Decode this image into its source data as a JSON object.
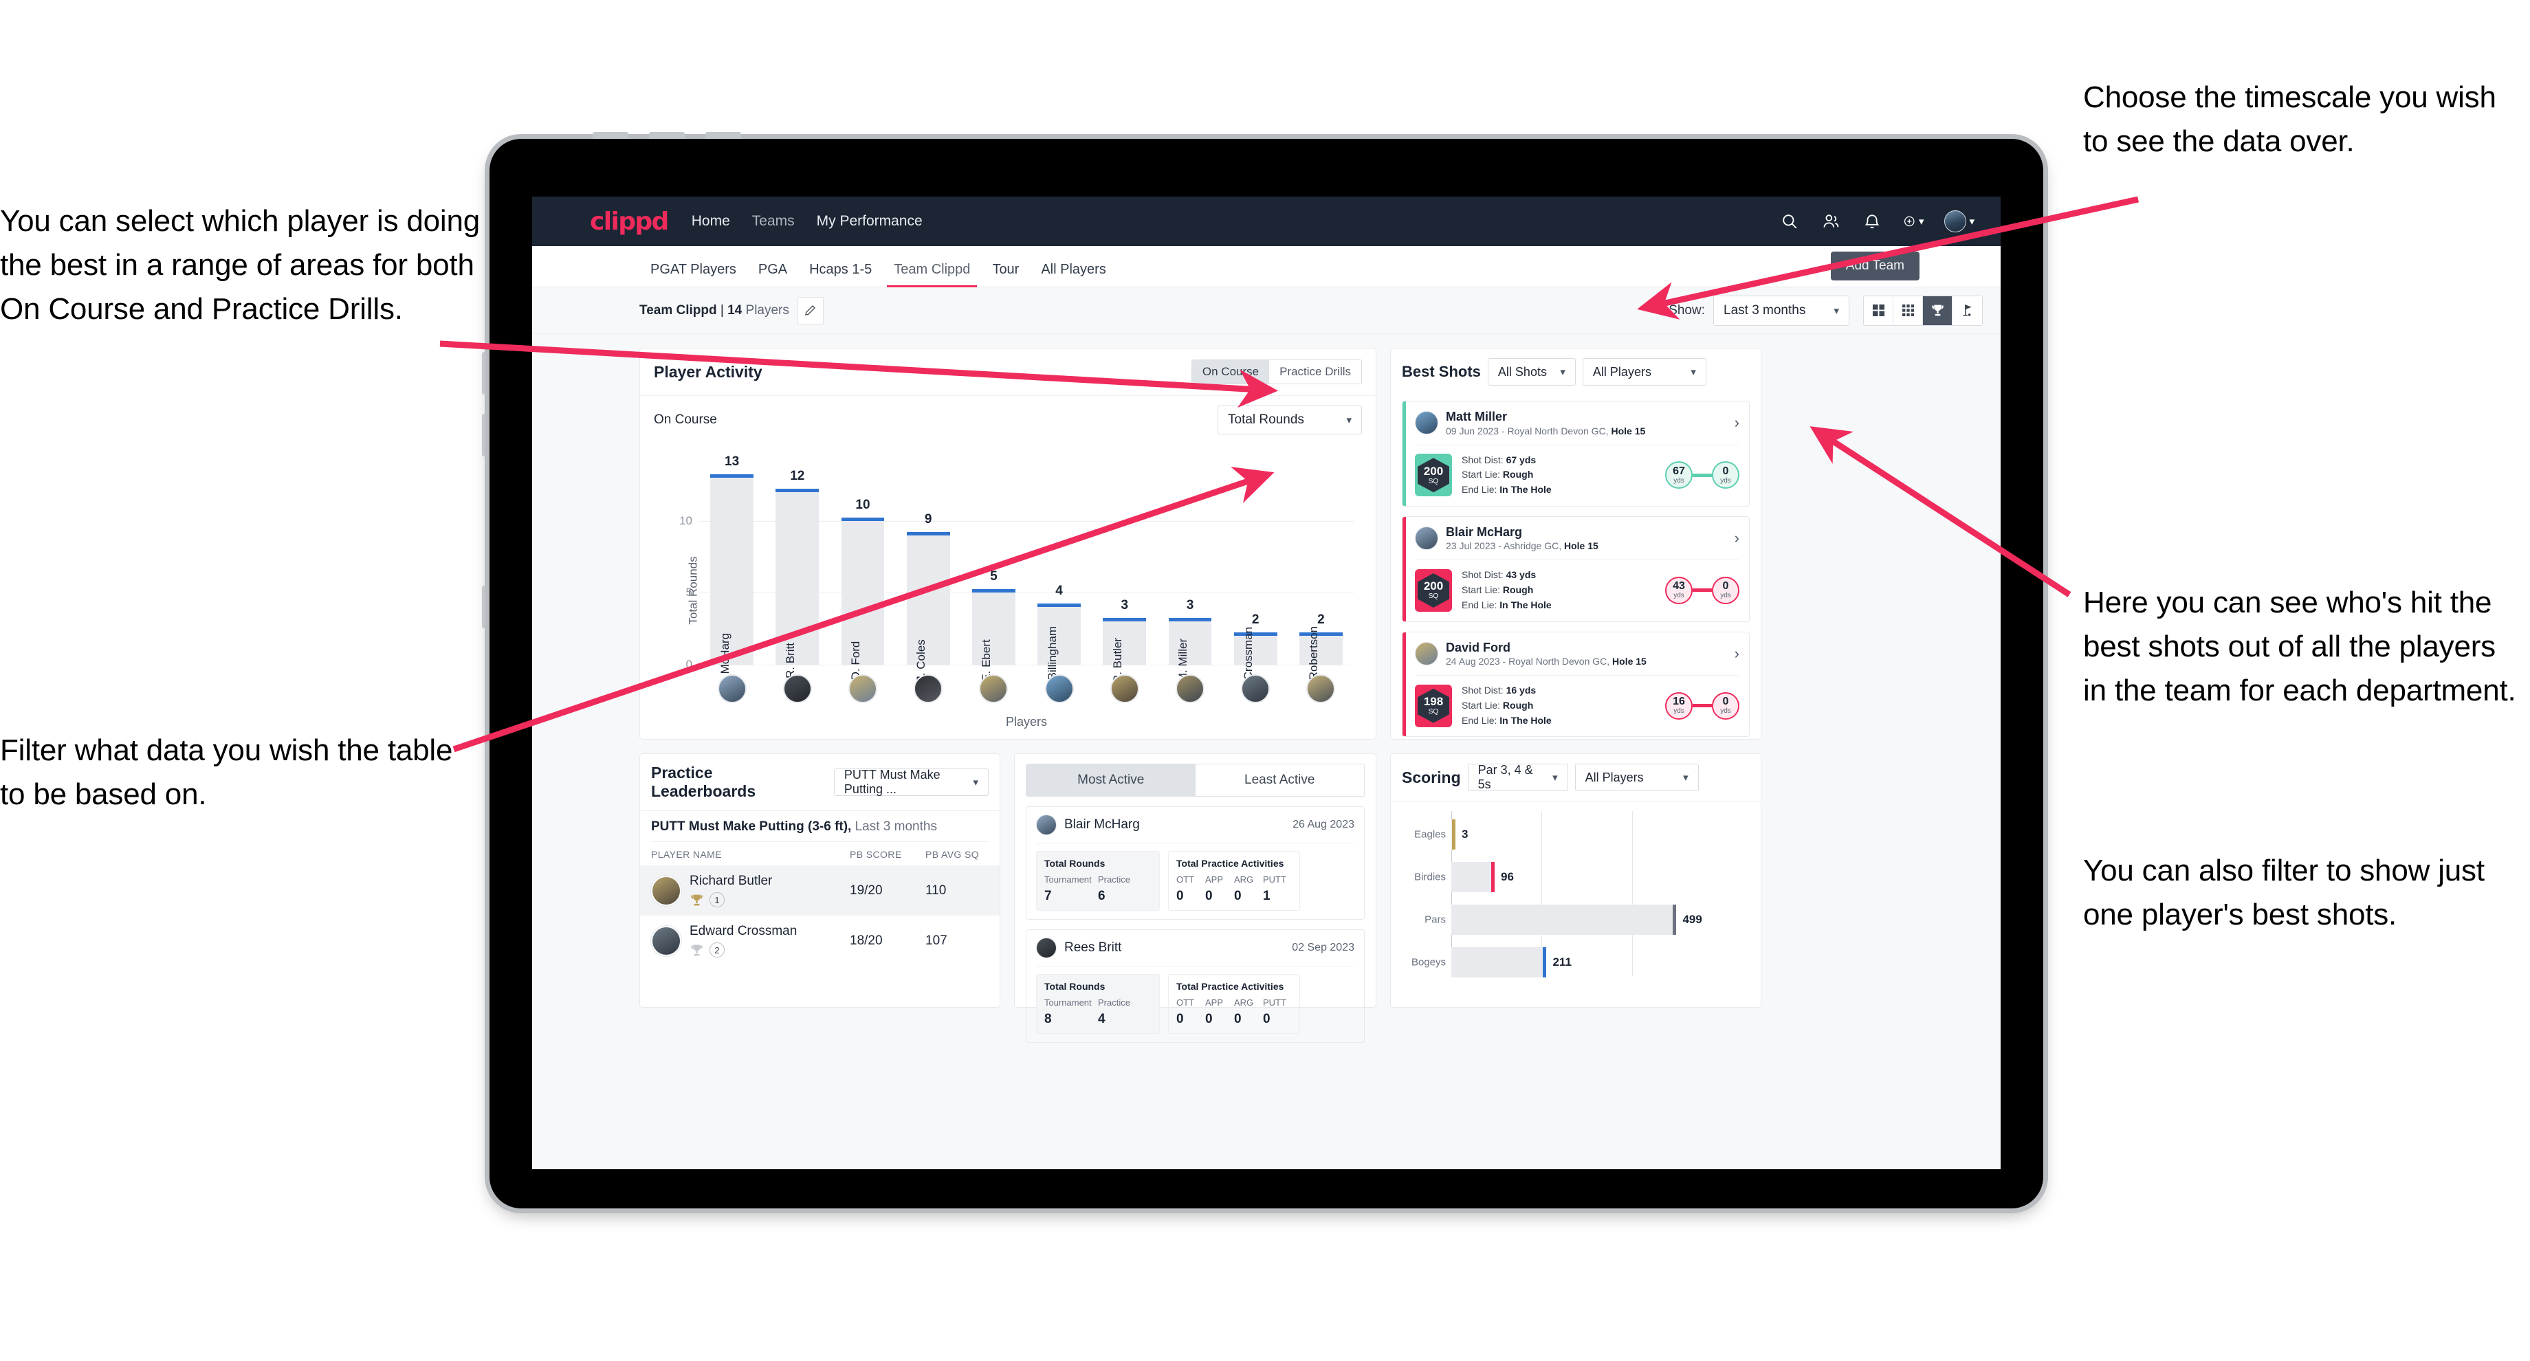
{
  "annotations": {
    "left_top": "You can select which player is doing the best in a range of areas for both On Course and Practice Drills.",
    "left_bottom": "Filter what data you wish the table to be based on.",
    "right_top": "Choose the timescale you wish to see the data over.",
    "right_middle": "Here you can see who's hit the best shots out of all the players in the team for each department.",
    "right_bottom": "You can also filter to show just one player's best shots."
  },
  "topnav": {
    "brand": "clippd",
    "links": [
      {
        "label": "Home"
      },
      {
        "label": "Teams"
      },
      {
        "label": "My Performance"
      }
    ],
    "icons": [
      "search-icon",
      "people-icon",
      "bell-icon",
      "plus-circle-icon",
      "avatar"
    ]
  },
  "tabs": [
    {
      "label": "PGAT Players",
      "active": false
    },
    {
      "label": "PGA",
      "active": false
    },
    {
      "label": "Hcaps 1-5",
      "active": false
    },
    {
      "label": "Team Clippd",
      "active": true
    },
    {
      "label": "Tour",
      "active": false
    },
    {
      "label": "All Players",
      "active": false
    }
  ],
  "add_team_button": "Add Team",
  "subbar": {
    "team_name": "Team Clippd",
    "separator": " | ",
    "player_count": "14",
    "players_word": " Players",
    "show_label": "Show:",
    "timescale_value": "Last 3 months",
    "view_toggles": [
      "grid-large-icon",
      "grid-small-icon",
      "trophy-icon",
      "flag-icon"
    ],
    "active_view": "trophy-icon"
  },
  "player_activity": {
    "title": "Player Activity",
    "segments": [
      {
        "label": "On Course",
        "active": true
      },
      {
        "label": "Practice Drills",
        "active": false
      }
    ],
    "sub_label": "On Course",
    "metric_value": "Total Rounds"
  },
  "best_shots": {
    "title": "Best Shots",
    "filter_shots": "All Shots",
    "filter_players": "All Players",
    "shots": [
      {
        "name": "Matt Miller",
        "meta_date": "09 Jun 2023 - Royal North Devon GC, ",
        "meta_hole": "Hole 15",
        "sq": "200",
        "sq_unit": "SQ",
        "shot_dist_label": "Shot Dist: ",
        "shot_dist": "67 yds",
        "start_lie_label": "Start Lie: ",
        "start_lie": "Rough",
        "end_lie_label": "End Lie: ",
        "end_lie": "In The Hole",
        "from_value": "67",
        "from_unit": "yds",
        "to_value": "0",
        "to_unit": "yds",
        "accent": "#5ccfb0"
      },
      {
        "name": "Blair McHarg",
        "meta_date": "23 Jul 2023 - Ashridge GC, ",
        "meta_hole": "Hole 15",
        "sq": "200",
        "sq_unit": "SQ",
        "shot_dist_label": "Shot Dist: ",
        "shot_dist": "43 yds",
        "start_lie_label": "Start Lie: ",
        "start_lie": "Rough",
        "end_lie_label": "End Lie: ",
        "end_lie": "In The Hole",
        "from_value": "43",
        "from_unit": "yds",
        "to_value": "0",
        "to_unit": "yds",
        "accent": "#ef2b5c"
      },
      {
        "name": "David Ford",
        "meta_date": "24 Aug 2023 - Royal North Devon GC, ",
        "meta_hole": "Hole 15",
        "sq": "198",
        "sq_unit": "SQ",
        "shot_dist_label": "Shot Dist: ",
        "shot_dist": "16 yds",
        "start_lie_label": "Start Lie: ",
        "start_lie": "Rough",
        "end_lie_label": "End Lie: ",
        "end_lie": "In The Hole",
        "from_value": "16",
        "from_unit": "yds",
        "to_value": "0",
        "to_unit": "yds",
        "accent": "#ef2b5c"
      }
    ]
  },
  "practice_leaderboards": {
    "title": "Practice Leaderboards",
    "drill_select": "PUTT Must Make Putting ...",
    "subtitle_bold": "PUTT Must Make Putting (3-6 ft),",
    "subtitle_light": " Last 3 months",
    "columns": [
      "PLAYER NAME",
      "PB SCORE",
      "PB AVG SQ"
    ],
    "rows": [
      {
        "name": "Richard Butler",
        "rank": "1",
        "trophy": "gold",
        "pb_score": "19/20",
        "pb_avg_sq": "110"
      },
      {
        "name": "Edward Crossman",
        "rank": "2",
        "trophy": "silver",
        "pb_score": "18/20",
        "pb_avg_sq": "107"
      }
    ]
  },
  "activity_panel": {
    "tabs": [
      {
        "label": "Most Active",
        "active": true
      },
      {
        "label": "Least Active",
        "active": false
      }
    ],
    "rounds_title": "Total Rounds",
    "rounds_headers": [
      "Tournament",
      "Practice"
    ],
    "practice_title": "Total Practice Activities",
    "practice_headers": [
      "OTT",
      "APP",
      "ARG",
      "PUTT"
    ],
    "entries": [
      {
        "name": "Blair McHarg",
        "date": "26 Aug 2023",
        "rounds": [
          "7",
          "6"
        ],
        "practice": [
          "0",
          "0",
          "0",
          "1"
        ]
      },
      {
        "name": "Rees Britt",
        "date": "02 Sep 2023",
        "rounds": [
          "8",
          "4"
        ],
        "practice": [
          "0",
          "0",
          "0",
          "0"
        ]
      }
    ]
  },
  "scoring": {
    "title": "Scoring",
    "filter_par": "Par 3, 4 & 5s",
    "filter_players": "All Players"
  },
  "chart_data": [
    {
      "type": "bar",
      "title": "Player Activity - On Course",
      "xlabel": "Players",
      "ylabel": "Total Rounds",
      "ylim": [
        0,
        14
      ],
      "yticks": [
        0,
        5,
        10
      ],
      "grid": true,
      "categories": [
        "B. McHarg",
        "R. Britt",
        "D. Ford",
        "J. Coles",
        "E. Ebert",
        "D. Billingham",
        "R. Butler",
        "M. Miller",
        "E. Crossman",
        "C. Robertson"
      ],
      "values": [
        13,
        12,
        10,
        9,
        5,
        4,
        3,
        3,
        2,
        2
      ],
      "bar_color": "#e9eaee",
      "cap_color": "#2f74d0"
    },
    {
      "type": "bar",
      "orientation": "horizontal",
      "title": "Scoring",
      "xlabel": "",
      "ylabel": "",
      "xlim": [
        0,
        640
      ],
      "categories": [
        "Eagles",
        "Birdies",
        "Pars",
        "Bogeys"
      ],
      "values": [
        3,
        96,
        499,
        211
      ],
      "tip_colors": [
        "#c0a254",
        "#ef2b5c",
        "#6b7280",
        "#2f74d0"
      ]
    }
  ]
}
